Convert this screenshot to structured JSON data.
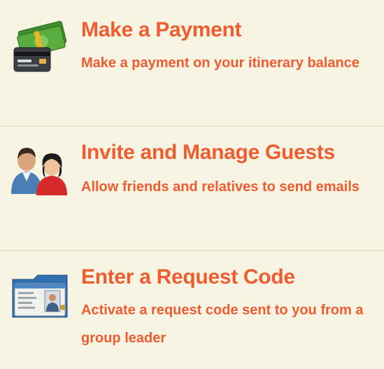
{
  "menu": {
    "items": [
      {
        "icon": "money-credit-card-icon",
        "title": "Make a Payment",
        "description": "Make a payment on your itinerary balance"
      },
      {
        "icon": "guests-people-icon",
        "title": "Invite and Manage Guests",
        "description": "Allow friends and relatives to send emails"
      },
      {
        "icon": "id-card-icon",
        "title": "Enter a Request Code",
        "description": "Activate a request code sent to you from a group leader"
      }
    ]
  },
  "colors": {
    "background": "#f7f4e4",
    "accent": "#ee5c30",
    "divider": "#e7e2cc"
  }
}
